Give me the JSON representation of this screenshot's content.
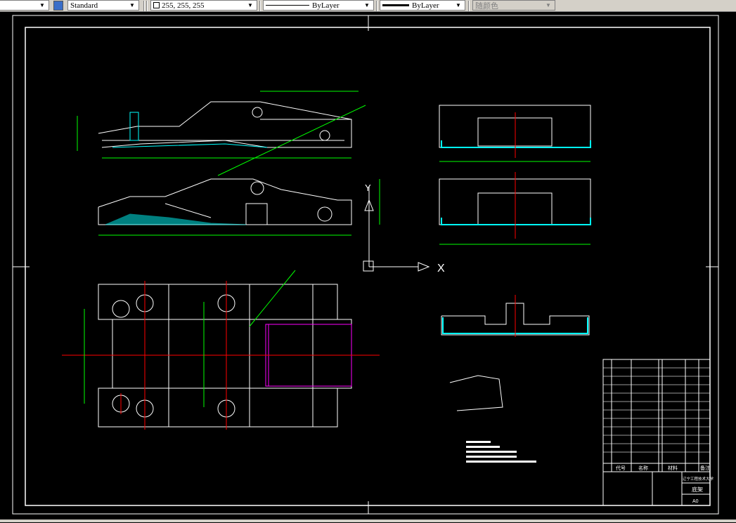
{
  "toolbar": {
    "textstyle_icon": "text-style-icon",
    "text_style": "Standard",
    "color": "255, 255, 255",
    "linetype": "ByLayer",
    "lineweight": "ByLayer",
    "plotstyle": "随颜色"
  },
  "drawing": {
    "ucs_x_label": "X",
    "ucs_y_label": "Y",
    "title_block": {
      "headers": [
        "代号",
        "名称",
        "材料",
        "备注"
      ],
      "school": "辽宁工程技术大学",
      "drawing_name": "底架",
      "sheet": "A0"
    }
  },
  "colors": {
    "background": "#000000",
    "lines": "#ffffff",
    "dimensions": "#00ff00",
    "centerlines": "#ff0000",
    "hatch": "#00ffff",
    "highlight": "#ff00ff"
  }
}
